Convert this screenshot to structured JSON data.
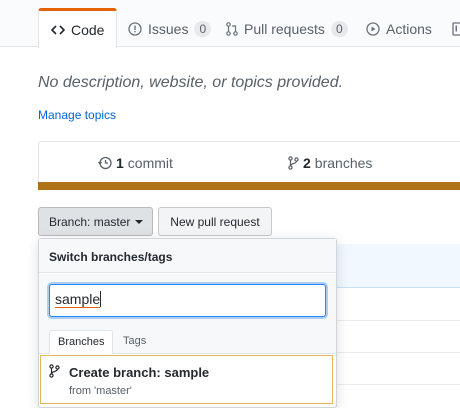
{
  "repo_nav": {
    "tabs": [
      {
        "label": "Code",
        "icon": "code-icon",
        "selected": true
      },
      {
        "label": "Issues",
        "icon": "issue-opened-icon",
        "count": "0"
      },
      {
        "label": "Pull requests",
        "icon": "git-pull-request-icon",
        "count": "0"
      },
      {
        "label": "Actions",
        "icon": "play-icon"
      }
    ]
  },
  "description": "No description, website, or topics provided.",
  "manage_topics": "Manage topics",
  "summary": {
    "commits_count": "1",
    "commits_label": "commit",
    "branches_count": "2",
    "branches_label": "branches"
  },
  "colors": {
    "language_bar": "#b07219",
    "selected_tab_accent": "#e36209",
    "create_branch_border": "#e2b659"
  },
  "branch_button": {
    "prefix": "Branch:",
    "branch": "master"
  },
  "new_pull_request": "New pull request",
  "dropdown": {
    "header": "Switch branches/tags",
    "filter_value": "sample",
    "tabs": [
      {
        "label": "Branches",
        "selected": true
      },
      {
        "label": "Tags"
      }
    ],
    "create": {
      "title": "Create branch: sample",
      "from": "from 'master'"
    }
  }
}
